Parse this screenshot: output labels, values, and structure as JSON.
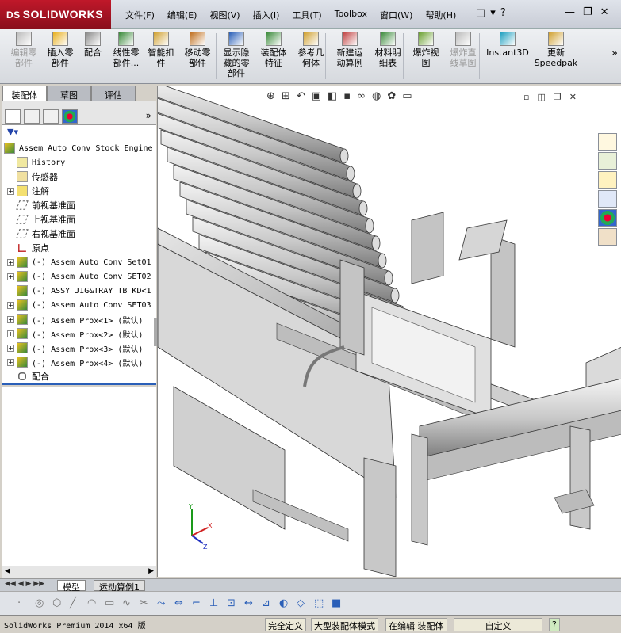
{
  "app": {
    "logo_prefix": "DS",
    "logo_name": "SOLIDWORKS"
  },
  "menu": [
    "文件(F)",
    "编辑(E)",
    "视图(V)",
    "插入(I)",
    "工具(T)",
    "Toolbox",
    "窗口(W)",
    "帮助(H)"
  ],
  "quick_access": {
    "new": "□",
    "open": "▾",
    "help": "?"
  },
  "window_controls": {
    "minimize": "—",
    "restore": "❐",
    "close": "✕"
  },
  "ribbon": [
    {
      "label": "编辑零\n部件",
      "disabled": true,
      "icon": "edit-component-icon"
    },
    {
      "label": "插入零\n部件",
      "disabled": false,
      "icon": "insert-component-icon"
    },
    {
      "label": "配合",
      "disabled": false,
      "icon": "mate-icon"
    },
    {
      "label": "线性零\n部件...",
      "disabled": false,
      "icon": "linear-pattern-icon"
    },
    {
      "label": "智能扣\n件",
      "disabled": false,
      "icon": "smart-fastener-icon"
    },
    {
      "label": "移动零\n部件",
      "disabled": false,
      "icon": "move-component-icon"
    },
    {
      "label": "显示隐\n藏的零\n部件",
      "disabled": false,
      "icon": "show-hidden-icon"
    },
    {
      "label": "装配体\n特征",
      "disabled": false,
      "icon": "assembly-feature-icon"
    },
    {
      "label": "参考几\n何体",
      "disabled": false,
      "icon": "reference-geometry-icon"
    },
    {
      "label": "新建运\n动算例",
      "disabled": false,
      "icon": "motion-study-icon"
    },
    {
      "label": "材料明\n细表",
      "disabled": false,
      "icon": "bom-icon"
    },
    {
      "label": "爆炸视\n图",
      "disabled": false,
      "icon": "exploded-view-icon"
    },
    {
      "label": "爆炸直\n线草图",
      "disabled": true,
      "icon": "explode-line-icon"
    },
    {
      "label": "Instant3D",
      "disabled": false,
      "icon": "instant3d-icon"
    },
    {
      "label": "更新\nSpeedpak",
      "disabled": false,
      "icon": "speedpak-icon"
    }
  ],
  "left_tabs": [
    "装配体",
    "草图",
    "评估"
  ],
  "filter_text": "▼▾",
  "tree": [
    {
      "label": "Assem Auto Conv Stock Engine",
      "mono": true,
      "plus": false,
      "icon": "assembly-icon",
      "indent": 0
    },
    {
      "label": "History",
      "mono": true,
      "plus": false,
      "icon": "history-icon",
      "indent": 1
    },
    {
      "label": "传感器",
      "mono": false,
      "plus": false,
      "icon": "sensor-icon",
      "indent": 1
    },
    {
      "label": "注解",
      "mono": false,
      "plus": true,
      "icon": "annotation-icon",
      "indent": 1
    },
    {
      "label": "前视基准面",
      "mono": false,
      "plus": false,
      "icon": "plane-icon",
      "indent": 1
    },
    {
      "label": "上视基准面",
      "mono": false,
      "plus": false,
      "icon": "plane-icon",
      "indent": 1
    },
    {
      "label": "右视基准面",
      "mono": false,
      "plus": false,
      "icon": "plane-icon",
      "indent": 1
    },
    {
      "label": "原点",
      "mono": false,
      "plus": false,
      "icon": "origin-icon",
      "indent": 1
    },
    {
      "label": "(-) Assem Auto Conv Set01",
      "mono": true,
      "plus": true,
      "icon": "subassembly-icon",
      "indent": 1
    },
    {
      "label": "(-) Assem Auto Conv SET02",
      "mono": true,
      "plus": true,
      "icon": "subassembly-icon",
      "indent": 1
    },
    {
      "label": "(-) ASSY JIG&TRAY TB KD<1",
      "mono": true,
      "plus": false,
      "icon": "subassembly-icon",
      "indent": 1
    },
    {
      "label": "(-) Assem Auto Conv SET03",
      "mono": true,
      "plus": true,
      "icon": "subassembly-icon",
      "indent": 1
    },
    {
      "label": "(-) Assem Prox<1> (默认)",
      "mono": true,
      "plus": true,
      "icon": "subassembly-icon",
      "indent": 1
    },
    {
      "label": "(-) Assem Prox<2> (默认)",
      "mono": true,
      "plus": true,
      "icon": "subassembly-icon",
      "indent": 1
    },
    {
      "label": "(-) Assem Prox<3> (默认)",
      "mono": true,
      "plus": true,
      "icon": "subassembly-icon",
      "indent": 1
    },
    {
      "label": "(-) Assem Prox<4> (默认)",
      "mono": true,
      "plus": true,
      "icon": "subassembly-icon",
      "indent": 1
    },
    {
      "label": "配合",
      "mono": false,
      "plus": false,
      "icon": "mates-icon",
      "indent": 1
    }
  ],
  "viewport": {
    "triad": {
      "x": "X",
      "y": "Y",
      "z": "Z"
    }
  },
  "bottom_tabs": [
    "模型",
    "运动算例1"
  ],
  "status": {
    "version": "SolidWorks Premium 2014 x64 版",
    "defined": "完全定义",
    "mode": "大型装配体模式",
    "editing": "在编辑 装配体",
    "custom": "自定义",
    "help": "?"
  },
  "colors": {
    "brand": "#c0182a",
    "accent": "#2a5fb8"
  }
}
